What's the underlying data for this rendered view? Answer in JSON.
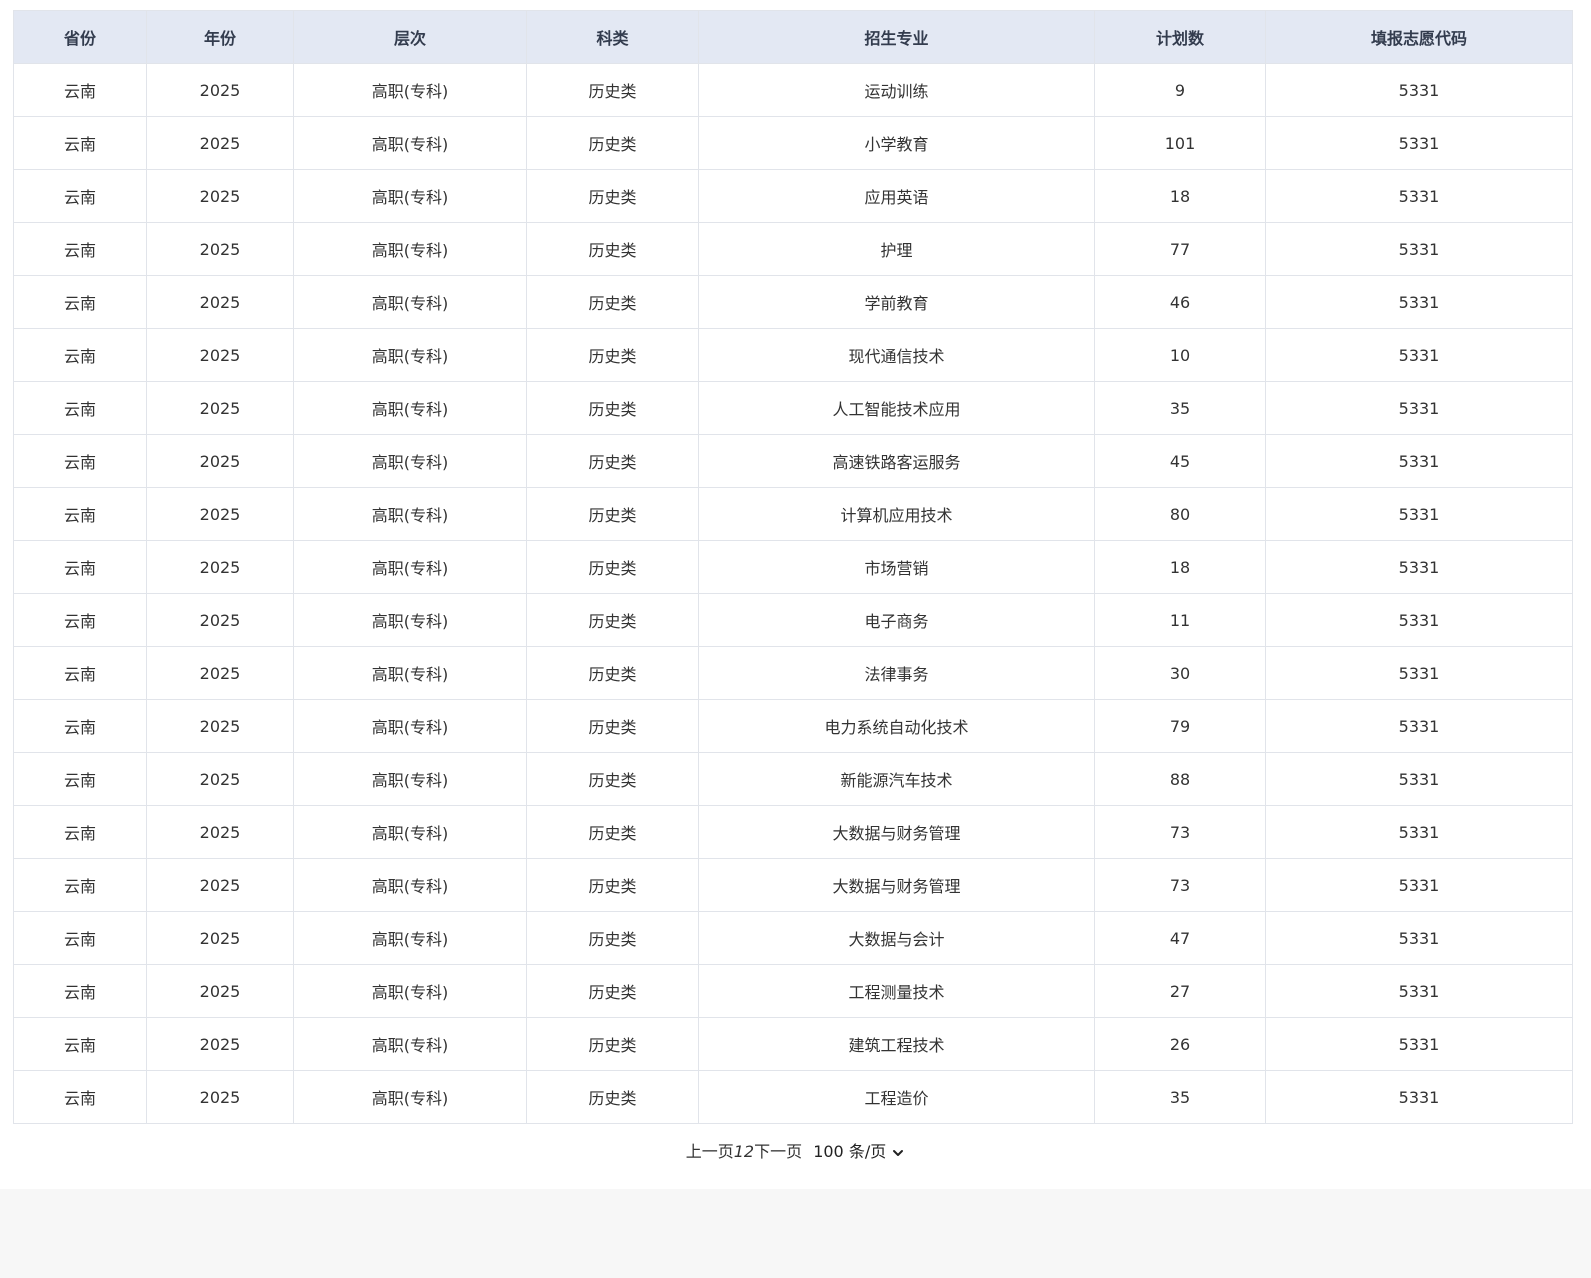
{
  "table": {
    "headers": [
      "省份",
      "年份",
      "层次",
      "科类",
      "招生专业",
      "计划数",
      "填报志愿代码"
    ],
    "rows": [
      [
        "云南",
        "2025",
        "高职(专科)",
        "历史类",
        "运动训练",
        "9",
        "5331"
      ],
      [
        "云南",
        "2025",
        "高职(专科)",
        "历史类",
        "小学教育",
        "101",
        "5331"
      ],
      [
        "云南",
        "2025",
        "高职(专科)",
        "历史类",
        "应用英语",
        "18",
        "5331"
      ],
      [
        "云南",
        "2025",
        "高职(专科)",
        "历史类",
        "护理",
        "77",
        "5331"
      ],
      [
        "云南",
        "2025",
        "高职(专科)",
        "历史类",
        "学前教育",
        "46",
        "5331"
      ],
      [
        "云南",
        "2025",
        "高职(专科)",
        "历史类",
        "现代通信技术",
        "10",
        "5331"
      ],
      [
        "云南",
        "2025",
        "高职(专科)",
        "历史类",
        "人工智能技术应用",
        "35",
        "5331"
      ],
      [
        "云南",
        "2025",
        "高职(专科)",
        "历史类",
        "高速铁路客运服务",
        "45",
        "5331"
      ],
      [
        "云南",
        "2025",
        "高职(专科)",
        "历史类",
        "计算机应用技术",
        "80",
        "5331"
      ],
      [
        "云南",
        "2025",
        "高职(专科)",
        "历史类",
        "市场营销",
        "18",
        "5331"
      ],
      [
        "云南",
        "2025",
        "高职(专科)",
        "历史类",
        "电子商务",
        "11",
        "5331"
      ],
      [
        "云南",
        "2025",
        "高职(专科)",
        "历史类",
        "法律事务",
        "30",
        "5331"
      ],
      [
        "云南",
        "2025",
        "高职(专科)",
        "历史类",
        "电力系统自动化技术",
        "79",
        "5331"
      ],
      [
        "云南",
        "2025",
        "高职(专科)",
        "历史类",
        "新能源汽车技术",
        "88",
        "5331"
      ],
      [
        "云南",
        "2025",
        "高职(专科)",
        "历史类",
        "大数据与财务管理",
        "73",
        "5331"
      ],
      [
        "云南",
        "2025",
        "高职(专科)",
        "历史类",
        "大数据与财务管理",
        "73",
        "5331"
      ],
      [
        "云南",
        "2025",
        "高职(专科)",
        "历史类",
        "大数据与会计",
        "47",
        "5331"
      ],
      [
        "云南",
        "2025",
        "高职(专科)",
        "历史类",
        "工程测量技术",
        "27",
        "5331"
      ],
      [
        "云南",
        "2025",
        "高职(专科)",
        "历史类",
        "建筑工程技术",
        "26",
        "5331"
      ],
      [
        "云南",
        "2025",
        "高职(专科)",
        "历史类",
        "工程造价",
        "35",
        "5331"
      ]
    ]
  },
  "pagination": {
    "prev_label": "上一页",
    "pages": [
      "1",
      "2"
    ],
    "next_label": "下一页",
    "page_size_label": "100 条/页",
    "chevron_icon": "chevron-down-icon"
  },
  "colors": {
    "header_bg": "#e3e8f3",
    "border": "#e1e4ea",
    "page_bg": "#f7f7f7"
  }
}
